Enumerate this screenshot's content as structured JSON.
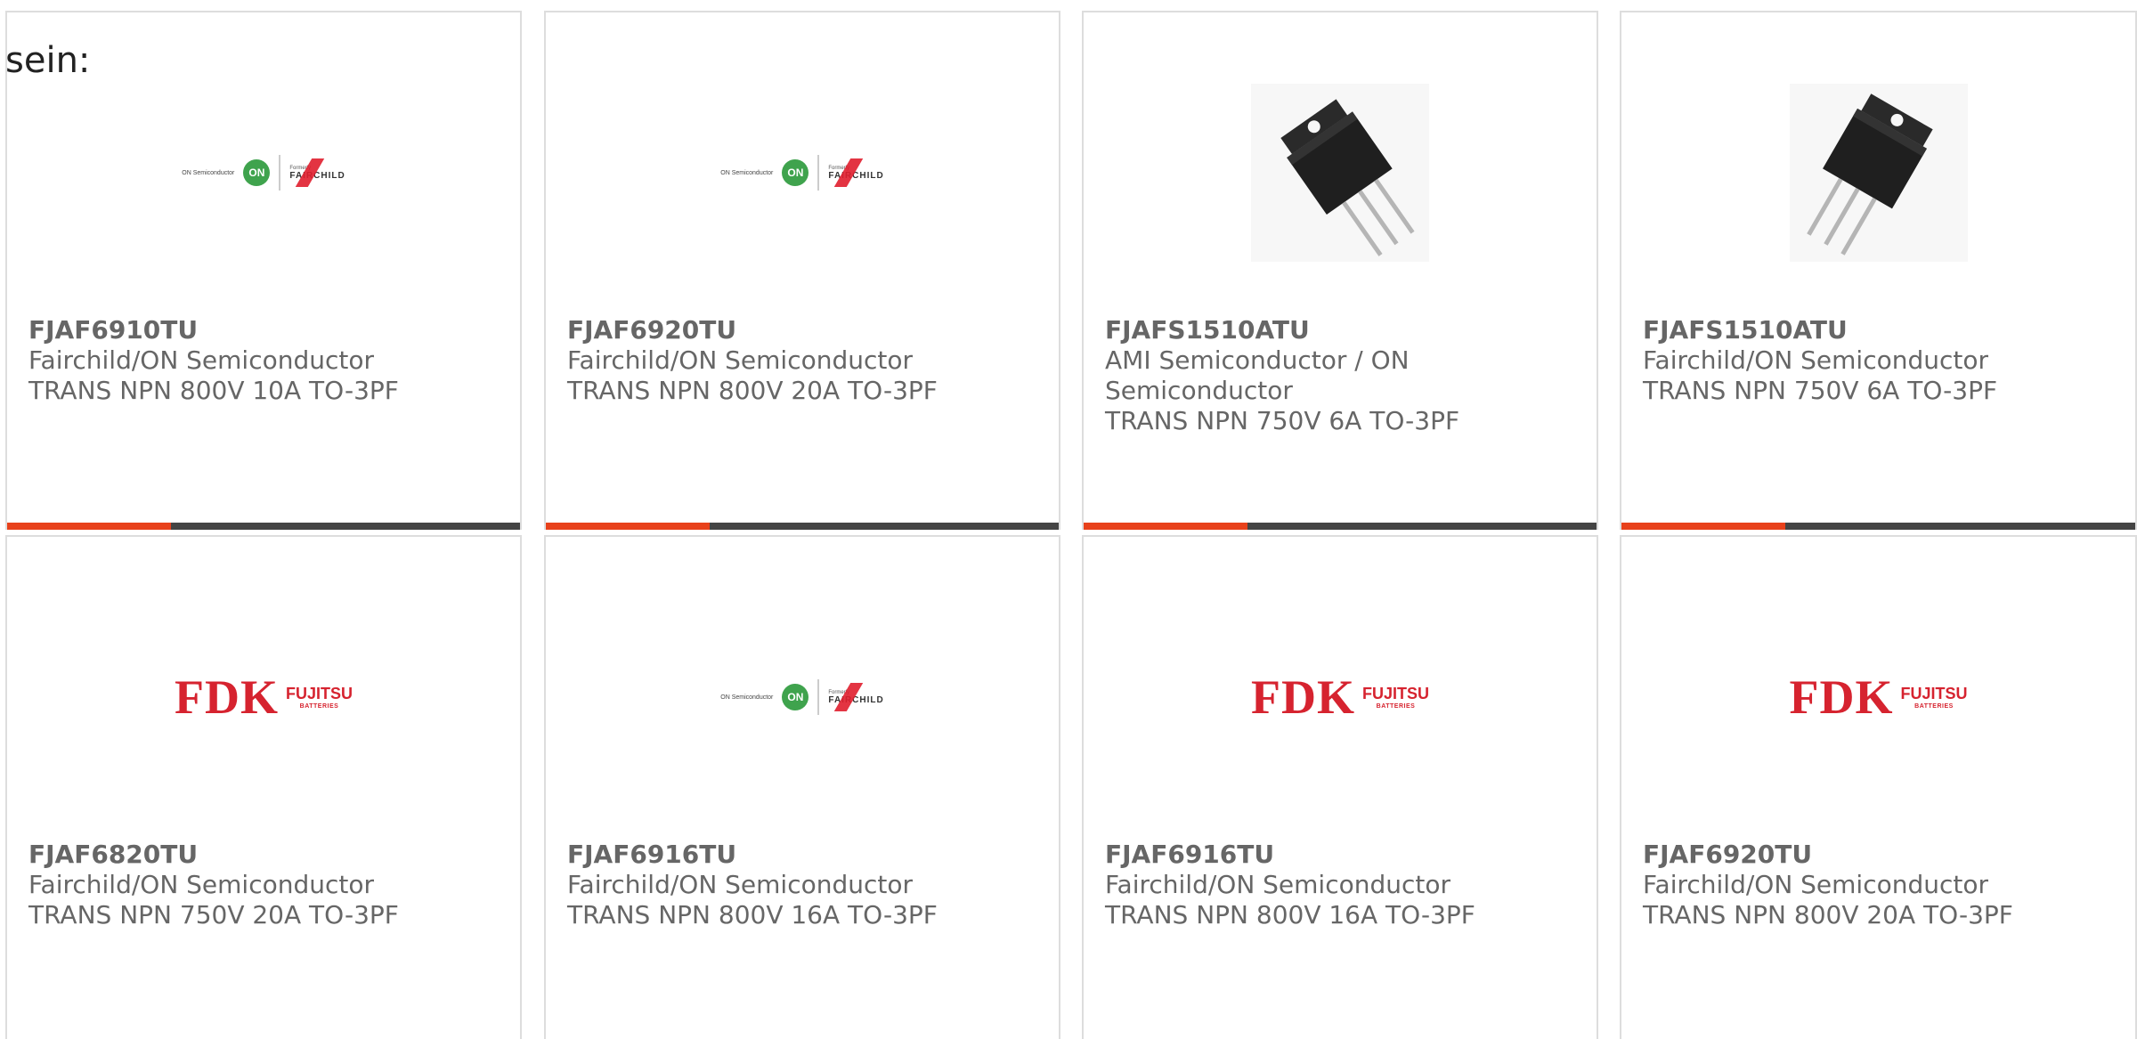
{
  "lead_text": "sein:",
  "colors": {
    "accent": "#e8411b",
    "bar": "#444444",
    "on_green": "#3fa34d",
    "fdk_red": "#d6232f",
    "text": "#666666"
  },
  "logos": {
    "on_fairchild": {
      "on_label": "ON Semiconductor",
      "on_mark": "ON",
      "formerly": "Formerly",
      "fairchild": "FAIRCHILD"
    },
    "fdk_fujitsu": {
      "fdk": "FDK",
      "fujitsu": "FUJITSU",
      "batteries": "BATTERIES"
    }
  },
  "products": [
    {
      "part": "FJAF6910TU",
      "manufacturer": "Fairchild/ON Semiconductor",
      "description": "TRANS NPN 800V 10A TO-3PF",
      "image": "on-fairchild-logo"
    },
    {
      "part": "FJAF6920TU",
      "manufacturer": "Fairchild/ON Semiconductor",
      "description": "TRANS NPN 800V 20A TO-3PF",
      "image": "on-fairchild-logo"
    },
    {
      "part": "FJAFS1510ATU",
      "manufacturer": "AMI Semiconductor / ON Semiconductor",
      "description": "TRANS NPN 750V 6A TO-3PF",
      "image": "transistor-photo"
    },
    {
      "part": "FJAFS1510ATU",
      "manufacturer": "Fairchild/ON Semiconductor",
      "description": "TRANS NPN 750V 6A TO-3PF",
      "image": "transistor-photo"
    },
    {
      "part": "FJAF6820TU",
      "manufacturer": "Fairchild/ON Semiconductor",
      "description": "TRANS NPN 750V 20A TO-3PF",
      "image": "fdk-fujitsu-logo"
    },
    {
      "part": "FJAF6916TU",
      "manufacturer": "Fairchild/ON Semiconductor",
      "description": "TRANS NPN 800V 16A TO-3PF",
      "image": "on-fairchild-logo"
    },
    {
      "part": "FJAF6916TU",
      "manufacturer": "Fairchild/ON Semiconductor",
      "description": "TRANS NPN 800V 16A TO-3PF",
      "image": "fdk-fujitsu-logo"
    },
    {
      "part": "FJAF6920TU",
      "manufacturer": "Fairchild/ON Semiconductor",
      "description": "TRANS NPN 800V 20A TO-3PF",
      "image": "fdk-fujitsu-logo"
    }
  ]
}
